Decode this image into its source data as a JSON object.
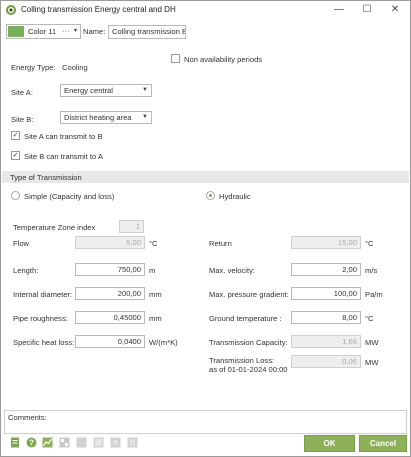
{
  "window": {
    "title": "Colling transmission Energy central and DH",
    "minimize_glyph": "—",
    "maximize_glyph": "☐",
    "close_glyph": "✕"
  },
  "header": {
    "color_label": "Color 11",
    "color_swatch": "#7ab05a",
    "color_more": "···",
    "name_label": "Name:",
    "name_value": "Colling transmission Er"
  },
  "general": {
    "non_availability_label": "Non availability periods",
    "energy_type_label": "Energy Type:",
    "energy_type_value": "Cooling",
    "site_a_label": "Site A:",
    "site_a_value": "Energy central",
    "site_b_label": "Site B:",
    "site_b_value": "District heating area",
    "site_a_transmit_label": "Site A can transmit to B",
    "site_b_transmit_label": "Site B can transmit to A",
    "check_glyph": "✓"
  },
  "transmission": {
    "section_title": "Type of Transmission",
    "simple_label": "Simple (Capacity and loss)",
    "hydraulic_label": "Hydraulic",
    "selected": "hydraulic"
  },
  "params": {
    "temp_zone_label": "Temperature Zone index",
    "temp_zone_value": "1",
    "flow_label": "Flow",
    "flow_value": "5,00",
    "flow_unit": "°C",
    "return_label": "Return",
    "return_value": "15,00",
    "return_unit": "°C",
    "length_label": "Length:",
    "length_value": "750,00",
    "length_unit": "m",
    "max_velocity_label": "Max. velocity:",
    "max_velocity_value": "2,00",
    "max_velocity_unit": "m/s",
    "internal_diameter_label": "Internal diameter:",
    "internal_diameter_value": "200,00",
    "internal_diameter_unit": "mm",
    "max_pressure_label": "Max. pressure gradient:",
    "max_pressure_value": "100,00",
    "max_pressure_unit": "Pa/m",
    "pipe_roughness_label": "Pipe roughness:",
    "pipe_roughness_value": "0,45000",
    "pipe_roughness_unit": "mm",
    "ground_temp_label": "Ground temperature :",
    "ground_temp_value": "8,00",
    "ground_temp_unit": "°C",
    "specific_heat_loss_label": "Specific heat loss:",
    "specific_heat_loss_value": "0,0400",
    "specific_heat_loss_unit": "W/(m*K)",
    "transmission_capacity_label": "Transmission Capacity:",
    "transmission_capacity_value": "1,66",
    "transmission_capacity_unit": "MW",
    "transmission_loss_label_1": "Transmission Loss:",
    "transmission_loss_label_2": "as of 01-01-2024 00:00",
    "transmission_loss_value": "0,06",
    "transmission_loss_unit": "MW"
  },
  "comments": {
    "label": "Comments:"
  },
  "footer": {
    "ok_label": "OK",
    "cancel_label": "Cancel",
    "toolbar_icons": [
      "document-icon",
      "help-icon",
      "chart-icon",
      "grid-icon",
      "copy-icon",
      "paste-icon",
      "calculate-icon",
      "export-icon"
    ]
  }
}
